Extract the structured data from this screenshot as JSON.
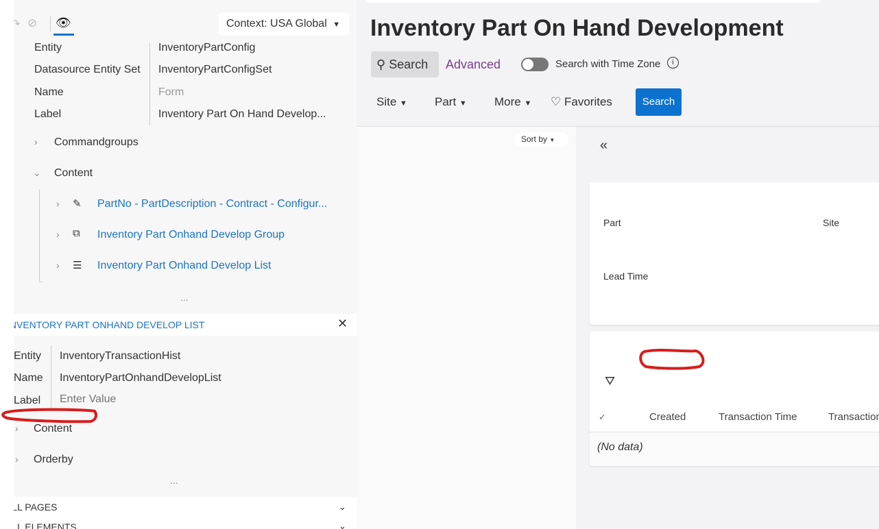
{
  "toolbar": {
    "context_label": "Context: USA Global"
  },
  "properties": [
    {
      "label": "Entity",
      "value": "InventoryPartConfig"
    },
    {
      "label": "Datasource Entity Set",
      "value": "InventoryPartConfigSet"
    },
    {
      "label": "Name",
      "value": "Form"
    },
    {
      "label": "Label",
      "value": "Inventory Part On Hand Develop..."
    }
  ],
  "tree": {
    "commandgroups": "Commandgroups",
    "content": "Content",
    "children": [
      {
        "label": "PartNo - PartDescription - Contract - Configur...",
        "icon": "form-icon"
      },
      {
        "label": "Inventory Part Onhand Develop Group",
        "icon": "group-icon"
      },
      {
        "label": "Inventory Part Onhand Develop List",
        "icon": "list-icon"
      }
    ],
    "more": "..."
  },
  "section": {
    "title": "INVENTORY PART ONHAND DEVELOP LIST",
    "properties": [
      {
        "label": "Entity",
        "value": "InventoryTransactionHist"
      },
      {
        "label": "Name",
        "value": "InventoryPartOnhandDevelopList"
      },
      {
        "label": "Label",
        "placeholder": "Enter Value"
      }
    ],
    "content": "Content",
    "orderby": "Orderby",
    "more": "..."
  },
  "bottom": {
    "all_pages": "ALL PAGES",
    "all_elements": "ALL ELEMENTS"
  },
  "page": {
    "title": "Inventory Part On Hand Development",
    "search_tab": "Search",
    "advanced_tab": "Advanced",
    "timezone_label": "Search with Time Zone",
    "timezone_on": false,
    "filters": [
      "Site",
      "Part",
      "More"
    ],
    "favorites": "Favorites",
    "search_button": "Search",
    "sort_by": "Sort by"
  },
  "detail": {
    "fields": [
      "Part",
      "Site",
      "Lead Time"
    ],
    "columns": [
      "Created",
      "Transaction Time",
      "Transaction"
    ],
    "no_data": "(No data)"
  },
  "colors": {
    "accent": "#0b72d0",
    "advanced": "#7b3f8f",
    "annotation": "#d91c1c"
  }
}
